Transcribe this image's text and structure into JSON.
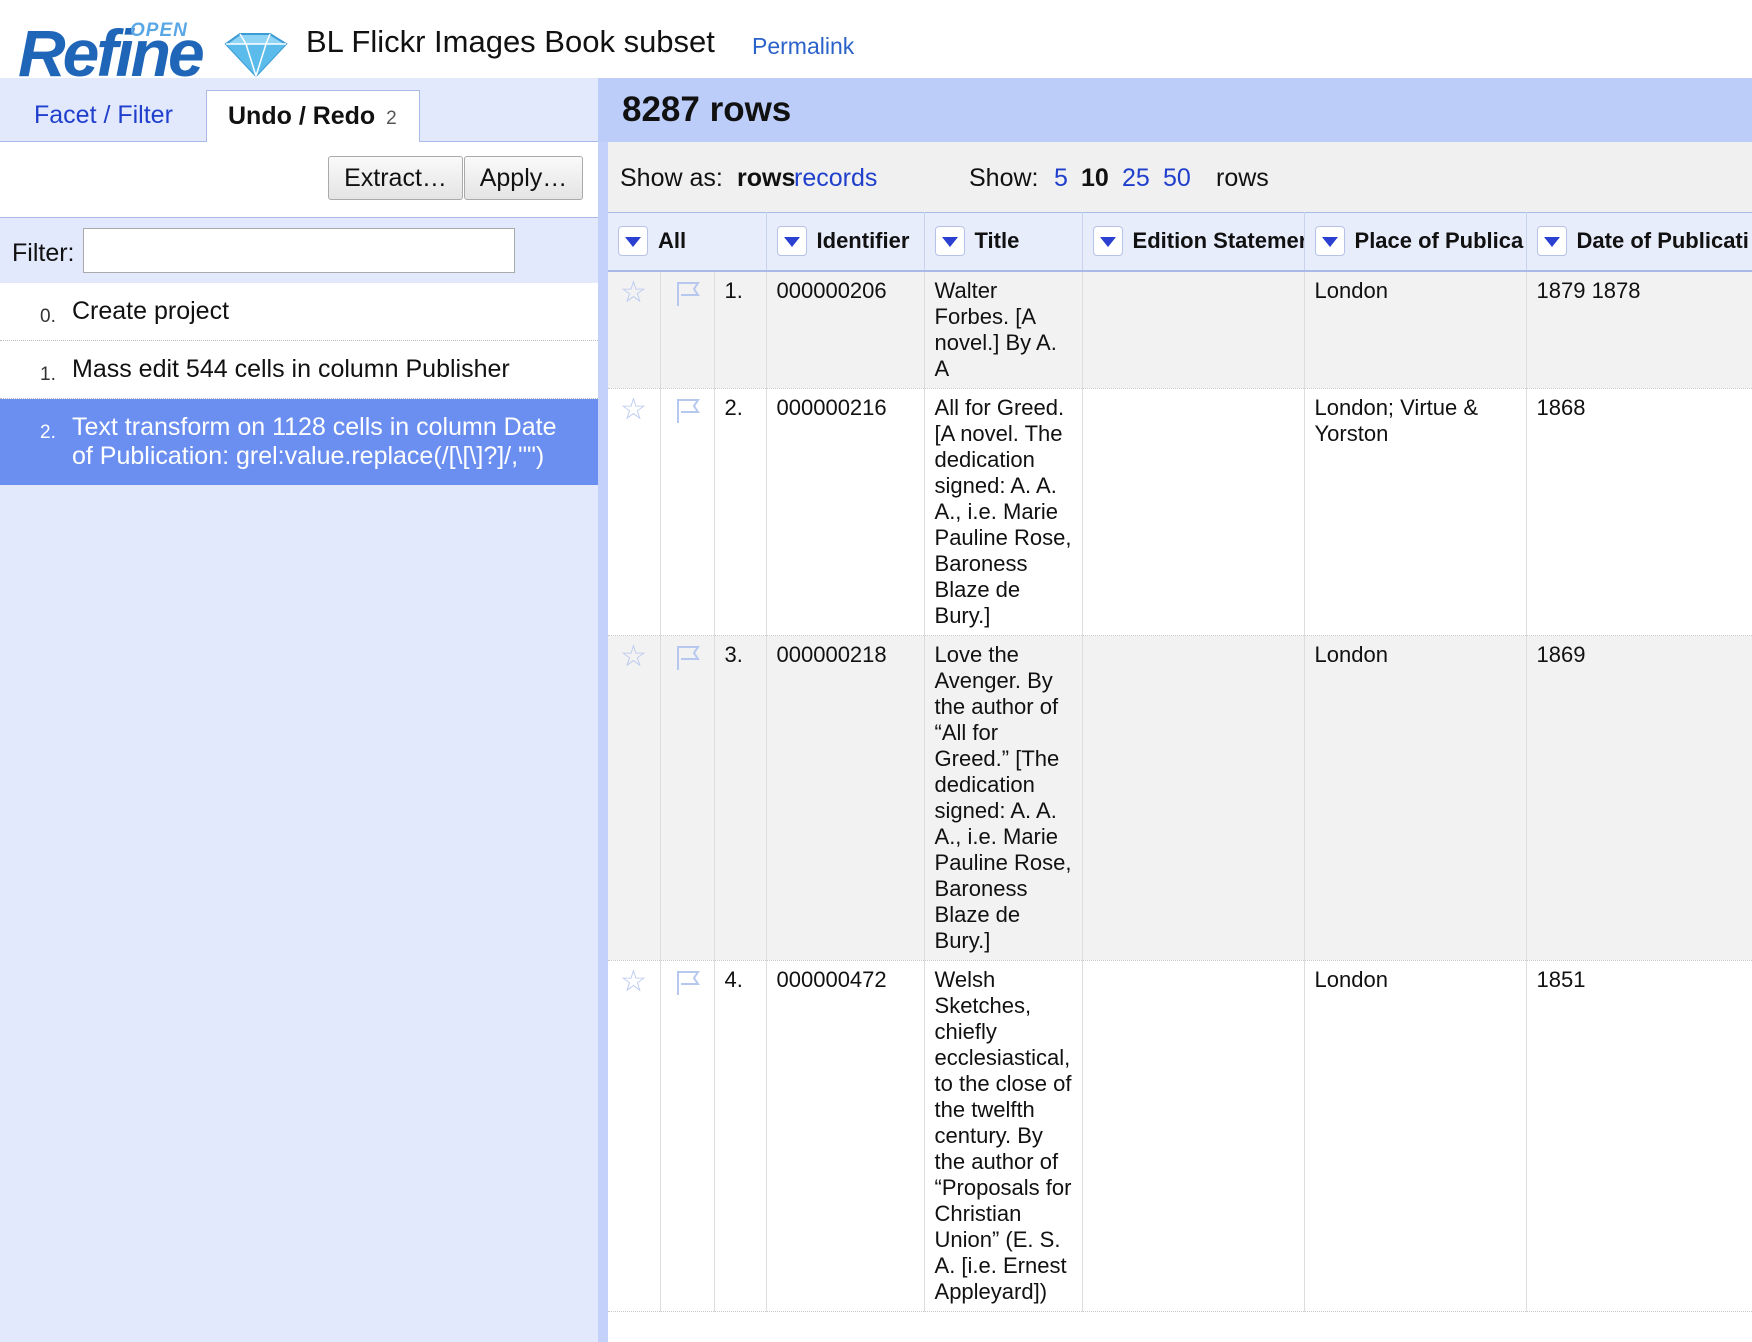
{
  "header": {
    "logo_open": "OPEN",
    "logo_refine": "Refine",
    "project_title": "BL Flickr Images Book subset",
    "permalink": "Permalink"
  },
  "left_panel": {
    "tabs": [
      {
        "label": "Facet / Filter"
      },
      {
        "label": "Undo / Redo",
        "count": "2"
      }
    ],
    "extract_label": "Extract…",
    "apply_label": "Apply…",
    "filter_label": "Filter:",
    "filter_value": "",
    "history": [
      {
        "num": "0.",
        "text": "Create project"
      },
      {
        "num": "1.",
        "text": "Mass edit 544 cells in column Publisher"
      },
      {
        "num": "2.",
        "text": "Text transform on 1128 cells in column Date of Publication: grel:value.replace(/[\\[\\]?]/,\"\")"
      }
    ]
  },
  "summary": {
    "row_count": "8287 rows"
  },
  "view_bar": {
    "show_as_label": "Show as:",
    "rows_mode": "rows",
    "records_mode": "records",
    "show_label": "Show:",
    "page_sizes": [
      "5",
      "10",
      "25",
      "50"
    ],
    "active_page_size": "10",
    "rows_suffix": "rows"
  },
  "table": {
    "columns": [
      "All",
      "Identifier",
      "Title",
      "Edition Statemer",
      "Place of Publica",
      "Date of Publicati"
    ],
    "rows": [
      {
        "num": "1.",
        "identifier": "000000206",
        "title": "Walter Forbes. [A novel.] By A. A",
        "edition": "",
        "place": "London",
        "date": "1879 1878"
      },
      {
        "num": "2.",
        "identifier": "000000216",
        "title": "All for Greed. [A novel. The dedication signed: A. A. A., i.e. Marie Pauline Rose, Baroness Blaze de Bury.]",
        "edition": "",
        "place": "London; Virtue & Yorston",
        "date": "1868"
      },
      {
        "num": "3.",
        "identifier": "000000218",
        "title": "Love the Avenger. By the author of “All for Greed.” [The dedication signed: A. A. A., i.e. Marie Pauline Rose, Baroness Blaze de Bury.]",
        "edition": "",
        "place": "London",
        "date": "1869"
      },
      {
        "num": "4.",
        "identifier": "000000472",
        "title": "Welsh Sketches, chiefly ecclesiastical, to the close of the twelfth century. By the author of “Proposals for Christian Union” (E. S. A. [i.e. Ernest Appleyard])",
        "edition": "",
        "place": "London",
        "date": "1851"
      }
    ]
  },
  "icons": {
    "star": "star-icon",
    "flag": "flag-icon",
    "dropdown": "dropdown-arrow-icon",
    "logo": "diamond-icon"
  },
  "colors": {
    "accent": "#6b8ff0",
    "link": "#1f3fcc",
    "summary_bg": "#bccdfa",
    "panel_bg": "#e3e9fd"
  }
}
